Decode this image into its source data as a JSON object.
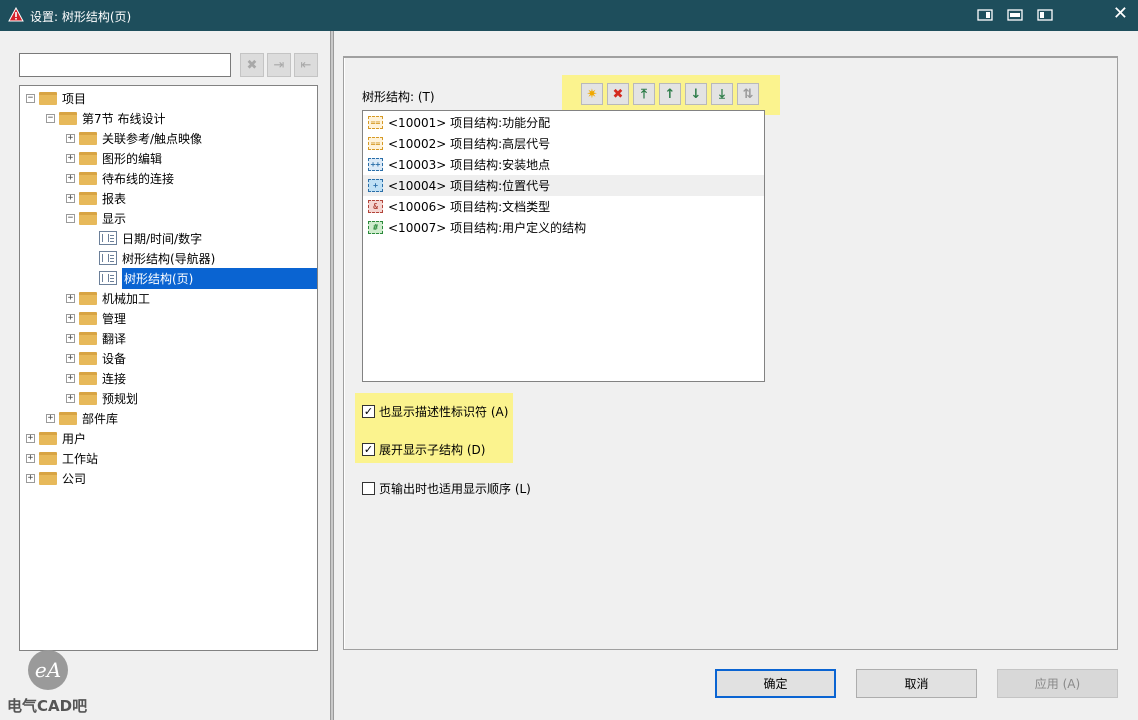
{
  "window": {
    "title": "设置: 树形结构(页)",
    "accent": "#1e4e5c"
  },
  "left": {
    "search_placeholder": "",
    "tree": [
      {
        "id": "project",
        "label": "项目",
        "level": 0,
        "expanded": true,
        "icon": "folder"
      },
      {
        "id": "sec7",
        "label": "第7节 布线设计",
        "level": 1,
        "expanded": true,
        "icon": "folder"
      },
      {
        "id": "ref",
        "label": "关联参考/触点映像",
        "level": 2,
        "expanded": false,
        "icon": "folder"
      },
      {
        "id": "edit",
        "label": "图形的编辑",
        "level": 2,
        "expanded": false,
        "icon": "folder"
      },
      {
        "id": "conn_pending",
        "label": "待布线的连接",
        "level": 2,
        "expanded": false,
        "icon": "folder"
      },
      {
        "id": "report",
        "label": "报表",
        "level": 2,
        "expanded": false,
        "icon": "folder"
      },
      {
        "id": "display",
        "label": "显示",
        "level": 2,
        "expanded": true,
        "icon": "folder"
      },
      {
        "id": "date",
        "label": "日期/时间/数字",
        "level": 3,
        "icon": "page"
      },
      {
        "id": "tree_nav",
        "label": "树形结构(导航器)",
        "level": 3,
        "icon": "page"
      },
      {
        "id": "tree_page",
        "label": "树形结构(页)",
        "level": 3,
        "icon": "page",
        "selected": true
      },
      {
        "id": "mech",
        "label": "机械加工",
        "level": 2,
        "expanded": false,
        "icon": "folder"
      },
      {
        "id": "manage",
        "label": "管理",
        "level": 2,
        "expanded": false,
        "icon": "folder"
      },
      {
        "id": "translate",
        "label": "翻译",
        "level": 2,
        "expanded": false,
        "icon": "folder"
      },
      {
        "id": "device",
        "label": "设备",
        "level": 2,
        "expanded": false,
        "icon": "folder"
      },
      {
        "id": "connection",
        "label": "连接",
        "level": 2,
        "expanded": false,
        "icon": "folder"
      },
      {
        "id": "preplan",
        "label": "预规划",
        "level": 2,
        "expanded": false,
        "icon": "folder"
      },
      {
        "id": "parts",
        "label": "部件库",
        "level": 1,
        "expanded": false,
        "icon": "folder"
      },
      {
        "id": "user",
        "label": "用户",
        "level": 0,
        "expanded": false,
        "icon": "folder"
      },
      {
        "id": "workstation",
        "label": "工作站",
        "level": 0,
        "expanded": false,
        "icon": "folder"
      },
      {
        "id": "company",
        "label": "公司",
        "level": 0,
        "expanded": false,
        "icon": "folder"
      }
    ],
    "logo_text": "电气CAD吧",
    "logo_glyph": "eA"
  },
  "right": {
    "tree_label": "树形结构: (T)",
    "list": [
      {
        "code": "<10001>",
        "text": "项目结构:功能分配",
        "icon_glyph": "==",
        "icon_color": "#d69a26",
        "icon_bg": "#fff3da"
      },
      {
        "code": "<10002>",
        "text": "项目结构:高层代号",
        "icon_glyph": "==",
        "icon_color": "#d69a26",
        "icon_bg": "#fff3da"
      },
      {
        "code": "<10003>",
        "text": "项目结构:安装地点",
        "icon_glyph": "++",
        "icon_color": "#2a6ea8",
        "icon_bg": "#dceaf7"
      },
      {
        "code": "<10004>",
        "text": "项目结构:位置代号",
        "icon_glyph": "+",
        "icon_color": "#2a6ea8",
        "icon_bg": "#bfe0f5"
      },
      {
        "code": "<10006>",
        "text": "项目结构:文档类型",
        "icon_glyph": "&",
        "icon_color": "#b2443a",
        "icon_bg": "#f5d6d2"
      },
      {
        "code": "<10007>",
        "text": "项目结构:用户定义的结构",
        "icon_glyph": "#",
        "icon_color": "#2a8a3a",
        "icon_bg": "#cfeccd"
      }
    ],
    "checkboxes": [
      {
        "label": "也显示描述性标识符 (A)",
        "checked": true
      },
      {
        "label": "展开显示子结构 (D)",
        "checked": true
      },
      {
        "label": "页输出时也适用显示顺序 (L)",
        "checked": false
      }
    ],
    "buttons": {
      "ok": "确定",
      "cancel": "取消",
      "apply": "应用 (A)"
    }
  }
}
